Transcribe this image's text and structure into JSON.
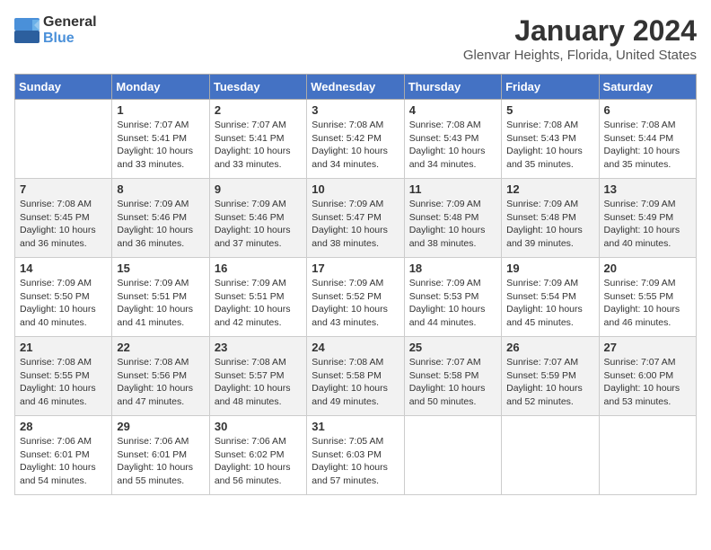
{
  "header": {
    "logo_line1": "General",
    "logo_line2": "Blue",
    "month": "January 2024",
    "location": "Glenvar Heights, Florida, United States"
  },
  "weekdays": [
    "Sunday",
    "Monday",
    "Tuesday",
    "Wednesday",
    "Thursday",
    "Friday",
    "Saturday"
  ],
  "weeks": [
    [
      {
        "day": "",
        "sunrise": "",
        "sunset": "",
        "daylight": ""
      },
      {
        "day": "1",
        "sunrise": "Sunrise: 7:07 AM",
        "sunset": "Sunset: 5:41 PM",
        "daylight": "Daylight: 10 hours and 33 minutes."
      },
      {
        "day": "2",
        "sunrise": "Sunrise: 7:07 AM",
        "sunset": "Sunset: 5:41 PM",
        "daylight": "Daylight: 10 hours and 33 minutes."
      },
      {
        "day": "3",
        "sunrise": "Sunrise: 7:08 AM",
        "sunset": "Sunset: 5:42 PM",
        "daylight": "Daylight: 10 hours and 34 minutes."
      },
      {
        "day": "4",
        "sunrise": "Sunrise: 7:08 AM",
        "sunset": "Sunset: 5:43 PM",
        "daylight": "Daylight: 10 hours and 34 minutes."
      },
      {
        "day": "5",
        "sunrise": "Sunrise: 7:08 AM",
        "sunset": "Sunset: 5:43 PM",
        "daylight": "Daylight: 10 hours and 35 minutes."
      },
      {
        "day": "6",
        "sunrise": "Sunrise: 7:08 AM",
        "sunset": "Sunset: 5:44 PM",
        "daylight": "Daylight: 10 hours and 35 minutes."
      }
    ],
    [
      {
        "day": "7",
        "sunrise": "Sunrise: 7:08 AM",
        "sunset": "Sunset: 5:45 PM",
        "daylight": "Daylight: 10 hours and 36 minutes."
      },
      {
        "day": "8",
        "sunrise": "Sunrise: 7:09 AM",
        "sunset": "Sunset: 5:46 PM",
        "daylight": "Daylight: 10 hours and 36 minutes."
      },
      {
        "day": "9",
        "sunrise": "Sunrise: 7:09 AM",
        "sunset": "Sunset: 5:46 PM",
        "daylight": "Daylight: 10 hours and 37 minutes."
      },
      {
        "day": "10",
        "sunrise": "Sunrise: 7:09 AM",
        "sunset": "Sunset: 5:47 PM",
        "daylight": "Daylight: 10 hours and 38 minutes."
      },
      {
        "day": "11",
        "sunrise": "Sunrise: 7:09 AM",
        "sunset": "Sunset: 5:48 PM",
        "daylight": "Daylight: 10 hours and 38 minutes."
      },
      {
        "day": "12",
        "sunrise": "Sunrise: 7:09 AM",
        "sunset": "Sunset: 5:48 PM",
        "daylight": "Daylight: 10 hours and 39 minutes."
      },
      {
        "day": "13",
        "sunrise": "Sunrise: 7:09 AM",
        "sunset": "Sunset: 5:49 PM",
        "daylight": "Daylight: 10 hours and 40 minutes."
      }
    ],
    [
      {
        "day": "14",
        "sunrise": "Sunrise: 7:09 AM",
        "sunset": "Sunset: 5:50 PM",
        "daylight": "Daylight: 10 hours and 40 minutes."
      },
      {
        "day": "15",
        "sunrise": "Sunrise: 7:09 AM",
        "sunset": "Sunset: 5:51 PM",
        "daylight": "Daylight: 10 hours and 41 minutes."
      },
      {
        "day": "16",
        "sunrise": "Sunrise: 7:09 AM",
        "sunset": "Sunset: 5:51 PM",
        "daylight": "Daylight: 10 hours and 42 minutes."
      },
      {
        "day": "17",
        "sunrise": "Sunrise: 7:09 AM",
        "sunset": "Sunset: 5:52 PM",
        "daylight": "Daylight: 10 hours and 43 minutes."
      },
      {
        "day": "18",
        "sunrise": "Sunrise: 7:09 AM",
        "sunset": "Sunset: 5:53 PM",
        "daylight": "Daylight: 10 hours and 44 minutes."
      },
      {
        "day": "19",
        "sunrise": "Sunrise: 7:09 AM",
        "sunset": "Sunset: 5:54 PM",
        "daylight": "Daylight: 10 hours and 45 minutes."
      },
      {
        "day": "20",
        "sunrise": "Sunrise: 7:09 AM",
        "sunset": "Sunset: 5:55 PM",
        "daylight": "Daylight: 10 hours and 46 minutes."
      }
    ],
    [
      {
        "day": "21",
        "sunrise": "Sunrise: 7:08 AM",
        "sunset": "Sunset: 5:55 PM",
        "daylight": "Daylight: 10 hours and 46 minutes."
      },
      {
        "day": "22",
        "sunrise": "Sunrise: 7:08 AM",
        "sunset": "Sunset: 5:56 PM",
        "daylight": "Daylight: 10 hours and 47 minutes."
      },
      {
        "day": "23",
        "sunrise": "Sunrise: 7:08 AM",
        "sunset": "Sunset: 5:57 PM",
        "daylight": "Daylight: 10 hours and 48 minutes."
      },
      {
        "day": "24",
        "sunrise": "Sunrise: 7:08 AM",
        "sunset": "Sunset: 5:58 PM",
        "daylight": "Daylight: 10 hours and 49 minutes."
      },
      {
        "day": "25",
        "sunrise": "Sunrise: 7:07 AM",
        "sunset": "Sunset: 5:58 PM",
        "daylight": "Daylight: 10 hours and 50 minutes."
      },
      {
        "day": "26",
        "sunrise": "Sunrise: 7:07 AM",
        "sunset": "Sunset: 5:59 PM",
        "daylight": "Daylight: 10 hours and 52 minutes."
      },
      {
        "day": "27",
        "sunrise": "Sunrise: 7:07 AM",
        "sunset": "Sunset: 6:00 PM",
        "daylight": "Daylight: 10 hours and 53 minutes."
      }
    ],
    [
      {
        "day": "28",
        "sunrise": "Sunrise: 7:06 AM",
        "sunset": "Sunset: 6:01 PM",
        "daylight": "Daylight: 10 hours and 54 minutes."
      },
      {
        "day": "29",
        "sunrise": "Sunrise: 7:06 AM",
        "sunset": "Sunset: 6:01 PM",
        "daylight": "Daylight: 10 hours and 55 minutes."
      },
      {
        "day": "30",
        "sunrise": "Sunrise: 7:06 AM",
        "sunset": "Sunset: 6:02 PM",
        "daylight": "Daylight: 10 hours and 56 minutes."
      },
      {
        "day": "31",
        "sunrise": "Sunrise: 7:05 AM",
        "sunset": "Sunset: 6:03 PM",
        "daylight": "Daylight: 10 hours and 57 minutes."
      },
      {
        "day": "",
        "sunrise": "",
        "sunset": "",
        "daylight": ""
      },
      {
        "day": "",
        "sunrise": "",
        "sunset": "",
        "daylight": ""
      },
      {
        "day": "",
        "sunrise": "",
        "sunset": "",
        "daylight": ""
      }
    ]
  ]
}
